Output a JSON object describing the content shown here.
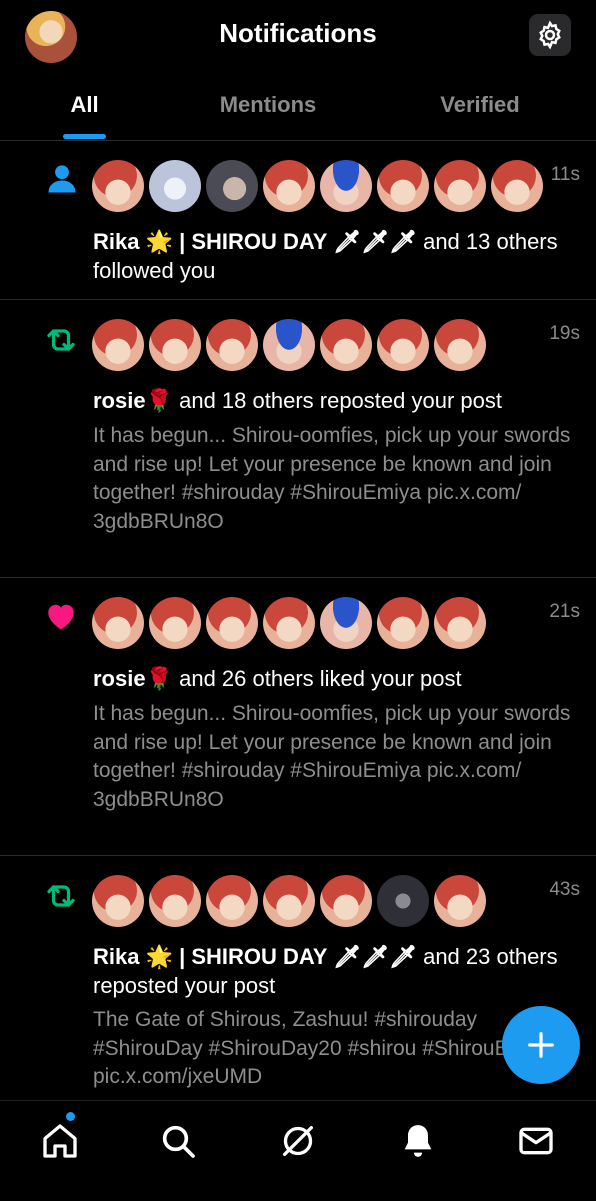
{
  "header": {
    "title": "Notifications"
  },
  "tabs": [
    {
      "label": "All",
      "active": true
    },
    {
      "label": "Mentions",
      "active": false
    },
    {
      "label": "Verified",
      "active": false
    }
  ],
  "notifications": [
    {
      "type": "follow",
      "icon": "person-icon",
      "time": "11s",
      "actor": "Rika 🌟 | SHIROU DAY 🗡🗡🗡",
      "rest": " and 13 others followed you",
      "body": ""
    },
    {
      "type": "repost",
      "icon": "repost-icon",
      "time": "19s",
      "actor": "rosie🌹",
      "rest": " and 18 others reposted your post",
      "body": "It has begun... Shirou-oomfies, pick up your swords and rise up! Let your presence be known and join together! #shirouday #ShirouEmiya pic.x.com/ 3gdbBRUn8O"
    },
    {
      "type": "like",
      "icon": "heart-icon",
      "time": "21s",
      "actor": "rosie🌹",
      "rest": " and 26 others liked your post",
      "body": "It has begun... Shirou-oomfies, pick up your swords and rise up! Let your presence be known and join together! #shirouday #ShirouEmiya pic.x.com/ 3gdbBRUn8O"
    },
    {
      "type": "repost",
      "icon": "repost-icon",
      "time": "43s",
      "actor": "Rika 🌟 | SHIROU DAY 🗡🗡🗡",
      "rest": " and 23 others reposted your post",
      "body": "The Gate of Shirous, Zashuu! #shirouday #ShirouDay #ShirouDay20 #shirou #ShirouEmiya pic.x.com/jxeUMD"
    }
  ],
  "colors": {
    "accent": "#1d9bf0",
    "repost": "#00ba7c",
    "like": "#f91880",
    "muted": "#8b8b8b"
  },
  "bottom_nav": [
    "home-icon",
    "search-icon",
    "grok-icon",
    "bell-icon",
    "mail-icon"
  ]
}
